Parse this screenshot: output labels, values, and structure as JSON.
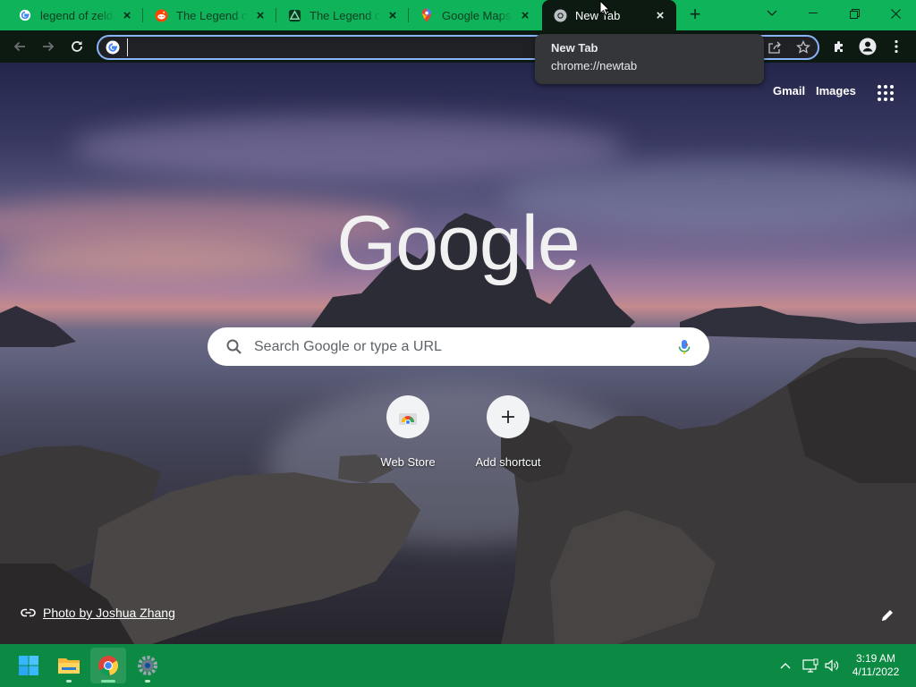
{
  "tabs": [
    {
      "title": "legend of zelda",
      "icon": "google-icon"
    },
    {
      "title": "The Legend of Zelda",
      "icon": "reddit-icon"
    },
    {
      "title": "The Legend of Zelda",
      "icon": "zelda-site-icon"
    },
    {
      "title": "Google Maps",
      "icon": "google-maps-icon"
    },
    {
      "title": "New Tab",
      "icon": "chrome-icon",
      "active": true
    }
  ],
  "tooltip": {
    "title": "New Tab",
    "url": "chrome://newtab"
  },
  "omnibox": {
    "value": ""
  },
  "toplinks": {
    "gmail": "Gmail",
    "images": "Images"
  },
  "logo": "Google",
  "search": {
    "placeholder": "Search Google or type a URL"
  },
  "shortcuts": [
    {
      "label": "Web Store",
      "icon": "web-store-icon"
    },
    {
      "label": "Add shortcut",
      "icon": "plus-icon"
    }
  ],
  "attribution": "Photo by Joshua Zhang",
  "taskbar": {
    "apps": [
      "start-icon",
      "file-explorer-icon",
      "chrome-icon",
      "settings-icon"
    ],
    "time": "3:19 AM",
    "date": "4/11/2022"
  },
  "colors": {
    "tabstrip": "#0fb35a",
    "taskbar": "#0c8a43",
    "toolbar": "#0c1a12",
    "focus": "#8ab4f8"
  }
}
